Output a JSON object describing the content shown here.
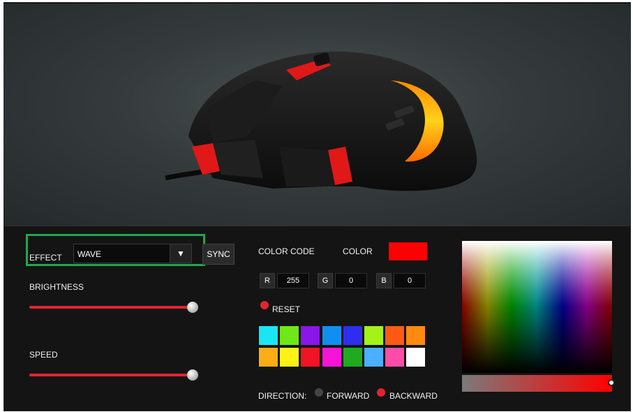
{
  "effect": {
    "label": "EFFECT",
    "value": "WAVE",
    "dropdown_arrow": "▼",
    "sync_label": "SYNC"
  },
  "brightness": {
    "label": "BRIGHTNESS",
    "level": 1.0
  },
  "speed": {
    "label": "SPEED",
    "level": 1.0
  },
  "color": {
    "code_label": "COLOR CODE",
    "color_label": "COLOR",
    "current_hex": "#ff0000",
    "r_label": "R",
    "r_value": "255",
    "g_label": "G",
    "g_value": "0",
    "b_label": "B",
    "b_value": "0",
    "reset_label": "RESET"
  },
  "palette": [
    "#19e6f2",
    "#6ee818",
    "#8a16e8",
    "#118ff0",
    "#2e2ef0",
    "#a4f218",
    "#ff5a14",
    "#ff8a10",
    "#ffad14",
    "#fff214",
    "#f01424",
    "#f614d6",
    "#1faa1f",
    "#4ab0ff",
    "#ff4ca8",
    "#ffffff"
  ],
  "direction": {
    "label": "DIRECTION:",
    "forward_label": "FORWARD",
    "backward_label": "BACKWARD",
    "selected": "BACKWARD"
  },
  "accent_color": "#e32330",
  "highlight_color": "#1fa84a"
}
